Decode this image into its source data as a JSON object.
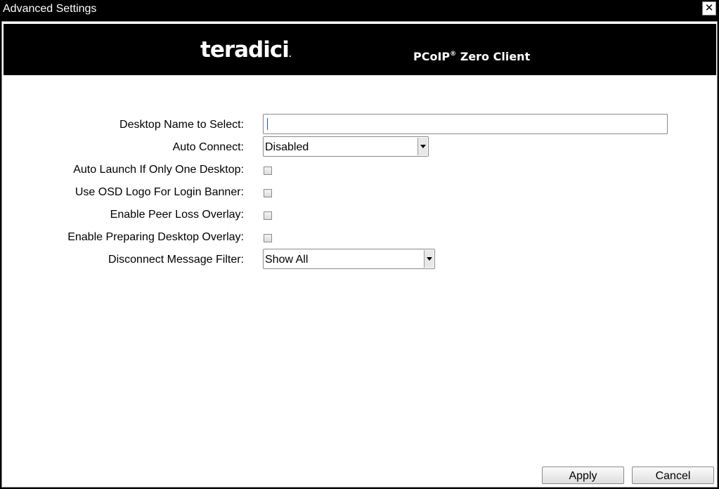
{
  "window": {
    "title": "Advanced Settings",
    "close_glyph": "✕"
  },
  "banner": {
    "logo_text": "teradici",
    "logo_dot": ".",
    "product_prefix": "PCoIP",
    "product_reg": "®",
    "product_suffix": " Zero Client"
  },
  "form": {
    "desktop_name": {
      "label": "Desktop Name to Select:",
      "value": ""
    },
    "auto_connect": {
      "label": "Auto Connect:",
      "value": "Disabled"
    },
    "auto_launch": {
      "label": "Auto Launch If Only One Desktop:",
      "checked": false
    },
    "osd_logo": {
      "label": "Use OSD Logo For Login Banner:",
      "checked": false
    },
    "peer_loss": {
      "label": "Enable Peer Loss Overlay:",
      "checked": false
    },
    "preparing_desktop": {
      "label": "Enable Preparing Desktop Overlay:",
      "checked": false
    },
    "disconnect_filter": {
      "label": "Disconnect Message Filter:",
      "value": "Show All"
    }
  },
  "buttons": {
    "apply": "Apply",
    "cancel": "Cancel"
  }
}
